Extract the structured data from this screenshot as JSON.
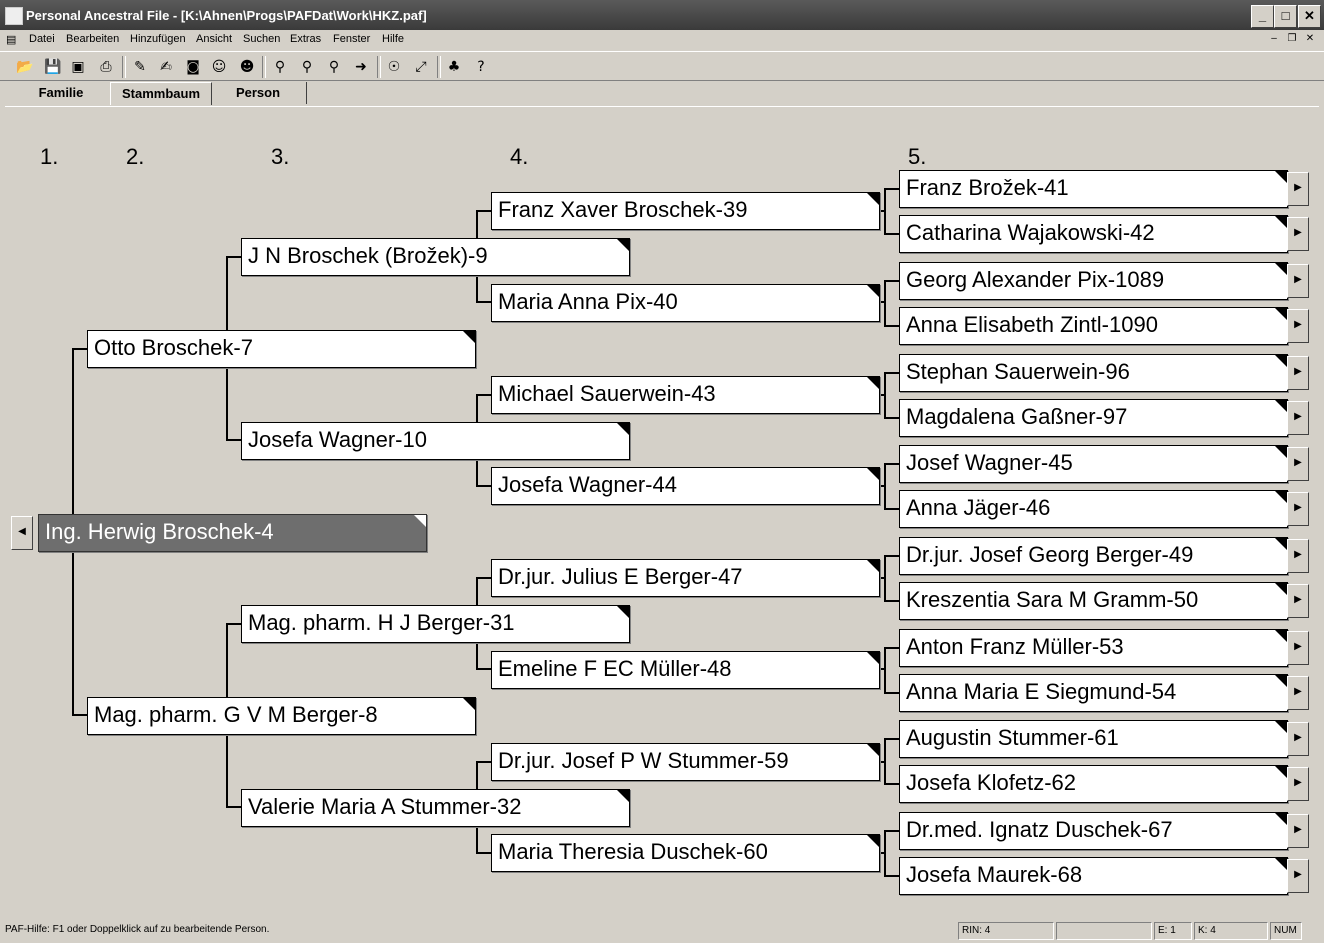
{
  "window": {
    "title": "Personal Ancestral File - [K:\\Ahnen\\Progs\\PAFDat\\Work\\HKZ.paf]"
  },
  "menu": {
    "items": [
      "Datei",
      "Bearbeiten",
      "Hinzufügen",
      "Ansicht",
      "Suchen",
      "Extras",
      "Fenster",
      "Hilfe"
    ]
  },
  "toolbar": {
    "icons": [
      "open-icon",
      "save-icon",
      "save-as-icon",
      "print-icon",
      "edit-icon",
      "notes-icon",
      "camera-icon",
      "add-person-icon",
      "family-icon",
      "find-icon",
      "find-next-icon",
      "search-icon",
      "goto-icon",
      "individual-icon",
      "merge-icon",
      "tree-icon",
      "help-icon"
    ]
  },
  "tabs": [
    {
      "label": "Familie"
    },
    {
      "label": "Stammbaum",
      "active": true
    },
    {
      "label": "Person"
    }
  ],
  "generations": [
    "1.",
    "2.",
    "3.",
    "4.",
    "5."
  ],
  "pedigree": {
    "gen1": [
      "Ing. Herwig Broschek-4"
    ],
    "gen2": [
      "Otto Broschek-7",
      "Mag. pharm. G V M Berger-8"
    ],
    "gen3": [
      "J N Broschek (Brožek)-9",
      "Josefa Wagner-10",
      "Mag. pharm. H J Berger-31",
      "Valerie Maria A Stummer-32"
    ],
    "gen4": [
      "Franz Xaver Broschek-39",
      "Maria Anna Pix-40",
      "Michael Sauerwein-43",
      "Josefa Wagner-44",
      "Dr.jur. Julius E Berger-47",
      "Emeline F EC Müller-48",
      "Dr.jur. Josef P W Stummer-59",
      "Maria Theresia Duschek-60"
    ],
    "gen5": [
      "Franz Brožek-41",
      "Catharina Wajakowski-42",
      "Georg Alexander Pix-1089",
      "Anna Elisabeth Zintl-1090",
      "Stephan Sauerwein-96",
      "Magdalena Gaßner-97",
      "Josef Wagner-45",
      "Anna Jäger-46",
      "Dr.jur. Josef Georg Berger-49",
      "Kreszentia Sara M Gramm-50",
      "Anton Franz Müller-53",
      "Anna Maria E Siegmund-54",
      "Augustin Stummer-61",
      "Josefa Klofetz-62",
      "Dr.med. Ignatz Duschek-67",
      "Josefa Maurek-68"
    ]
  },
  "status": {
    "help": "PAF-Hilfe: F1 oder Doppelklick auf zu bearbeitende Person.",
    "rin": "RIN: 4",
    "e": "E: 1",
    "k": "K: 4",
    "num": "NUM"
  }
}
